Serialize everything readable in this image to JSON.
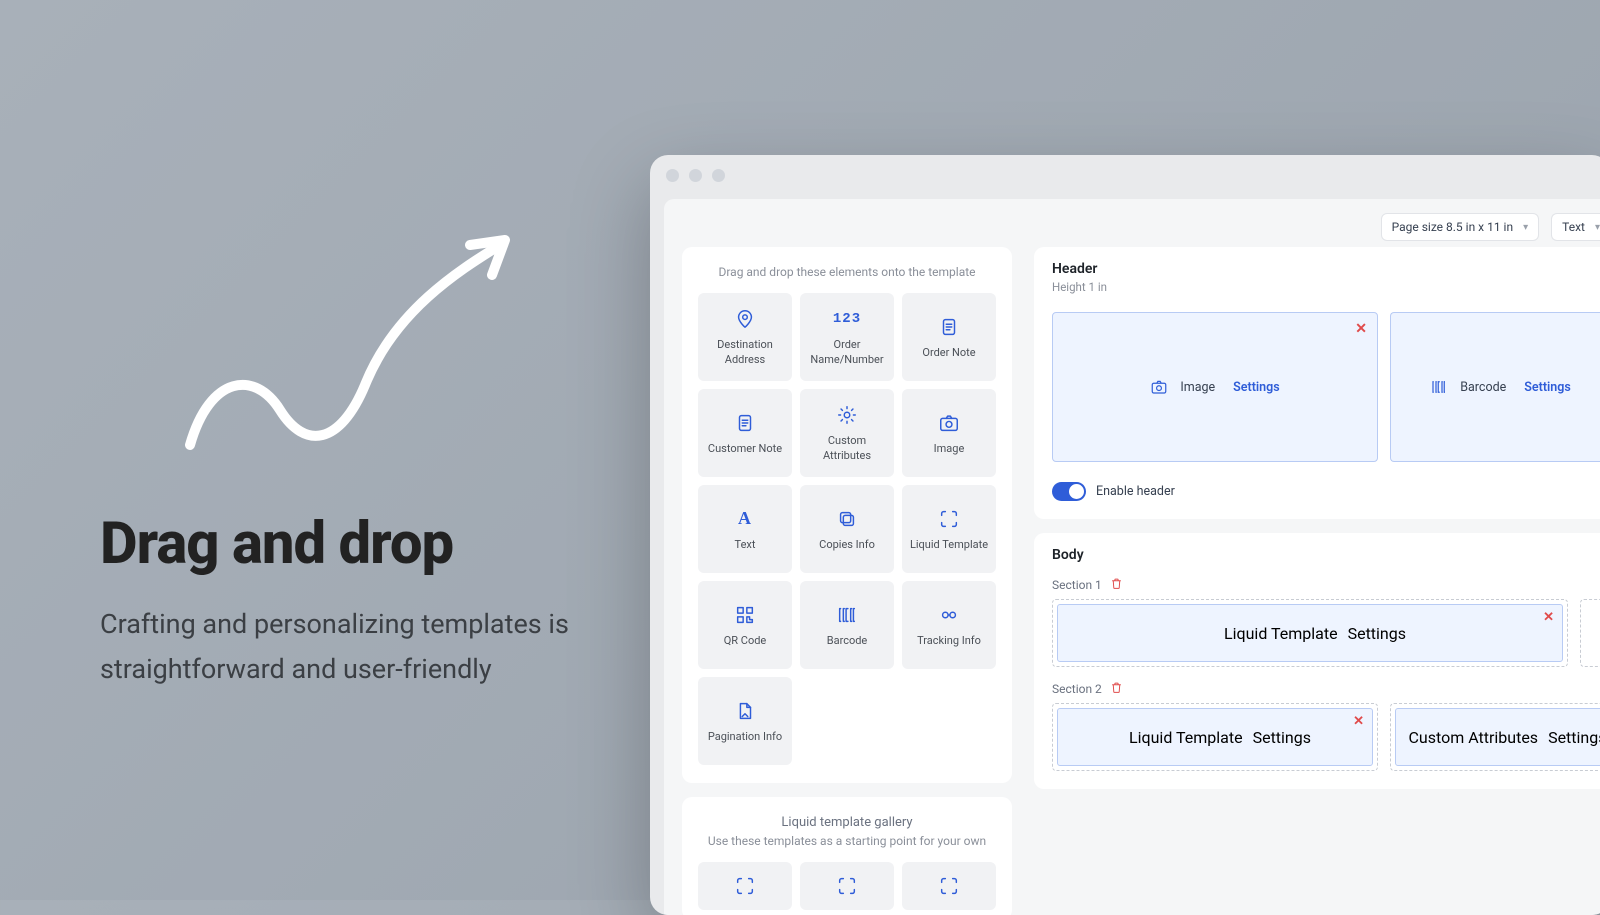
{
  "promo": {
    "title": "Drag and drop",
    "subtitle": "Crafting and personalizing templates is straightforward and user-friendly"
  },
  "toolbar": {
    "page_size_label": "Page size 8.5 in x 11 in",
    "text_label": "Text"
  },
  "elements_panel": {
    "hint": "Drag and drop these elements onto the template",
    "items": [
      {
        "icon": "pin",
        "label": "Destination Address"
      },
      {
        "icon": "123",
        "label": "Order Name/Number"
      },
      {
        "icon": "note",
        "label": "Order Note"
      },
      {
        "icon": "note",
        "label": "Customer Note"
      },
      {
        "icon": "sun",
        "label": "Custom Attributes"
      },
      {
        "icon": "camera",
        "label": "Image"
      },
      {
        "icon": "A",
        "label": "Text"
      },
      {
        "icon": "copies",
        "label": "Copies Info"
      },
      {
        "icon": "liquid",
        "label": "Liquid Template"
      },
      {
        "icon": "qr",
        "label": "QR Code"
      },
      {
        "icon": "barcode",
        "label": "Barcode"
      },
      {
        "icon": "tracking",
        "label": "Tracking Info"
      },
      {
        "icon": "page",
        "label": "Pagination Info"
      }
    ]
  },
  "gallery": {
    "title": "Liquid template gallery",
    "hint": "Use these templates as a starting point for your own"
  },
  "header_section": {
    "title": "Header",
    "sub": "Height 1 in",
    "blocks": [
      {
        "icon": "camera",
        "label": "Image",
        "settings": "Settings"
      },
      {
        "icon": "barcode",
        "label": "Barcode",
        "settings": "Settings"
      }
    ],
    "enable_label": "Enable header",
    "enabled": true
  },
  "body_section": {
    "title": "Body",
    "sections": [
      {
        "label": "Section 1",
        "blocks": [
          {
            "icon": "liquid",
            "label": "Liquid Template",
            "settings": "Settings"
          }
        ],
        "cut_right": true
      },
      {
        "label": "Section 2",
        "blocks": [
          {
            "icon": "liquid",
            "label": "Liquid Template",
            "settings": "Settings"
          },
          {
            "icon": "sun",
            "label": "Custom Attributes",
            "settings": "Settings"
          }
        ]
      }
    ]
  }
}
